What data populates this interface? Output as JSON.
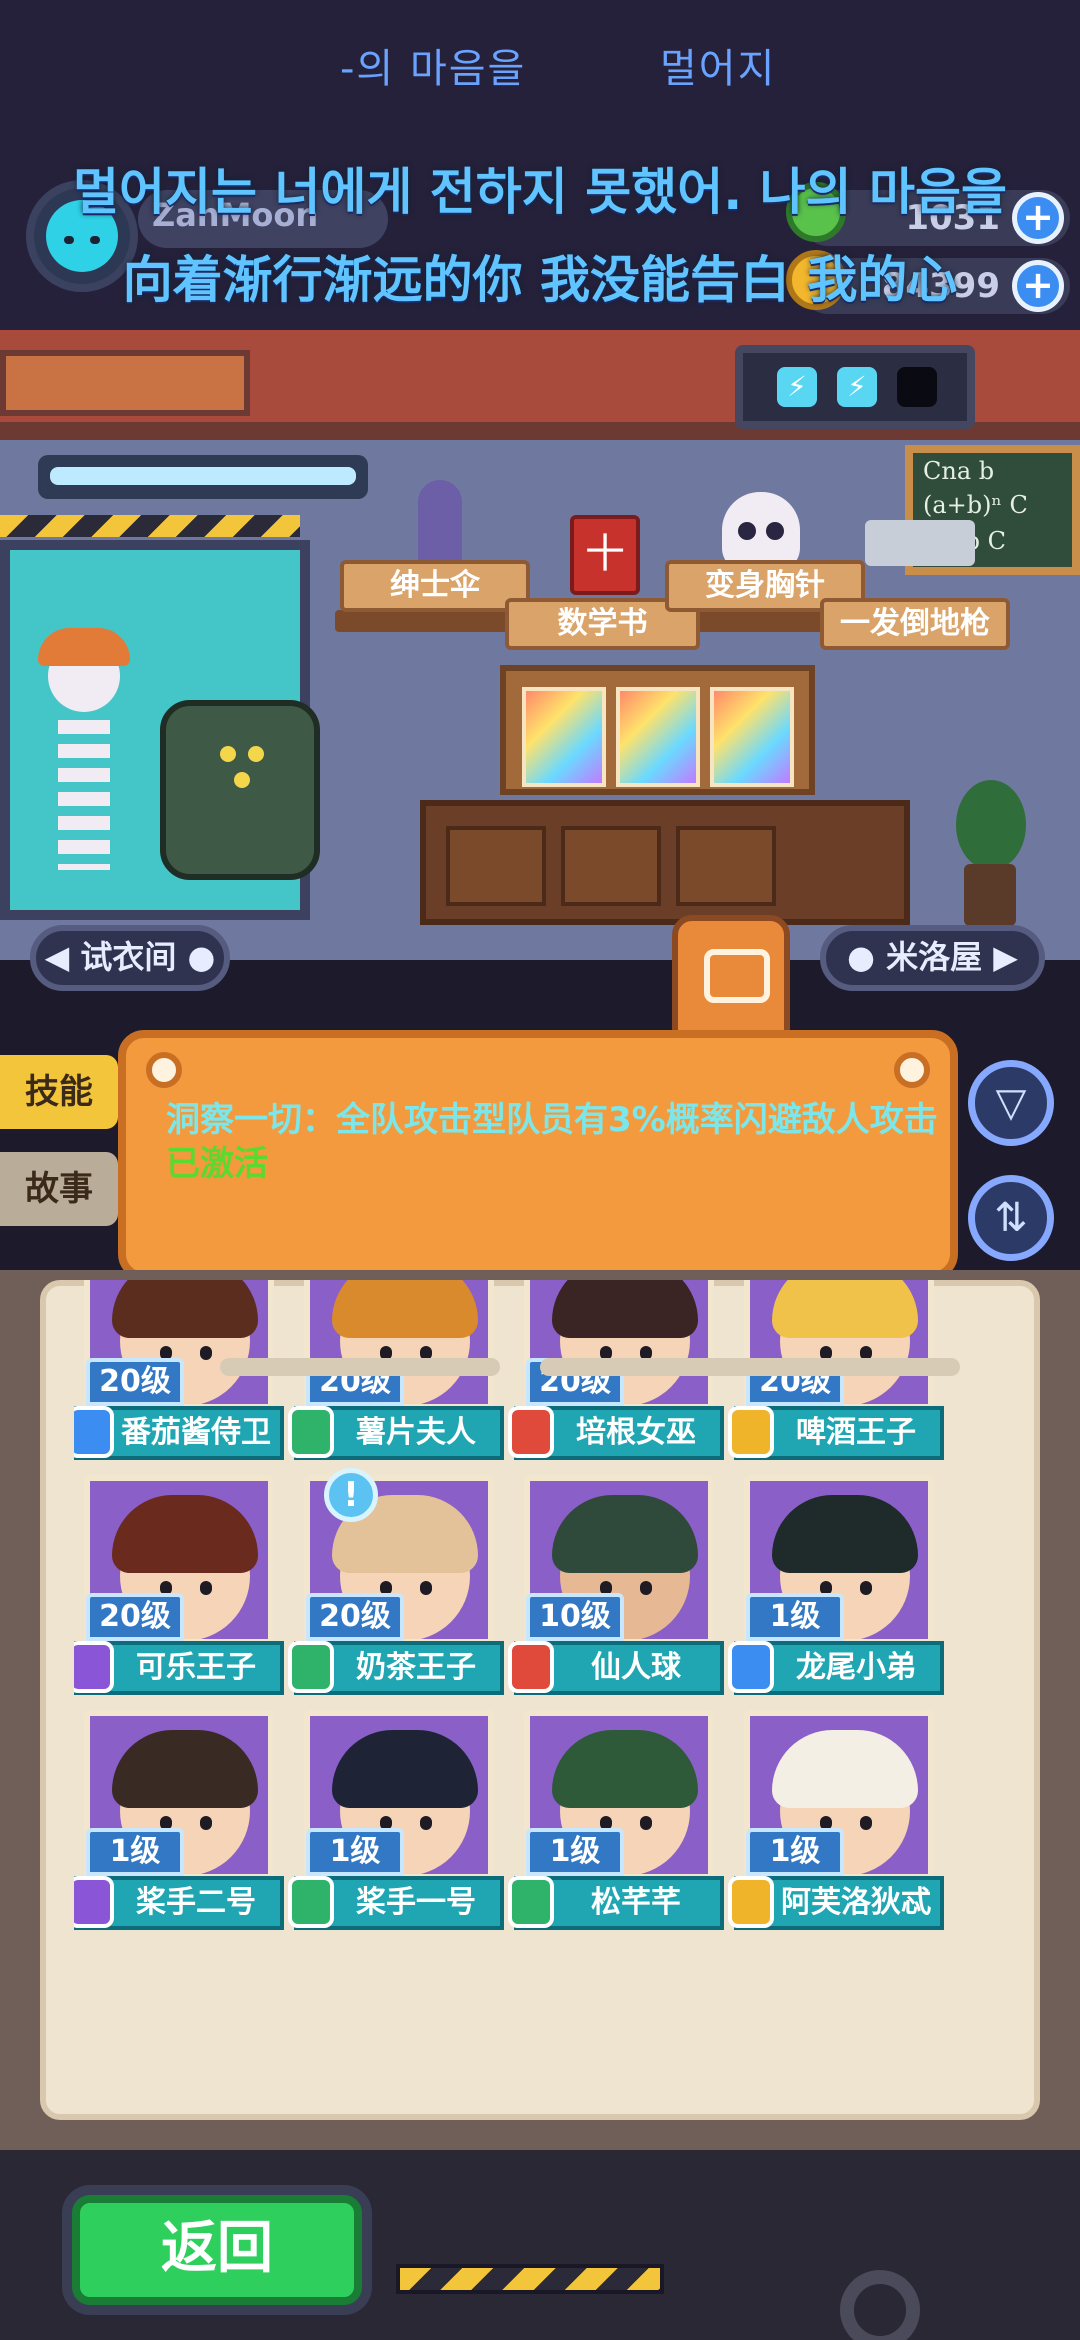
{
  "lyrics": {
    "top_fragment_left": "-의 마음을",
    "top_fragment_right": "멀어지",
    "korean": "멀어지는 너에게 전하지 못했어. 나의 마음을",
    "chinese": "向着渐行渐远的你 我没能告白 我的心"
  },
  "player": {
    "name": "ZanMoon",
    "currency_1": "1031",
    "currency_2": "84399",
    "plus_label": "+"
  },
  "energy": {
    "bolt_icon": "⚡"
  },
  "room_items": {
    "item_1": "绅士伞",
    "item_2": "数学书",
    "item_3": "变身胸针",
    "item_4": "一发倒地枪",
    "board_line_1": "Cna b",
    "board_line_2": "(a+b)ⁿ C",
    "board_line_3": "²a-²b C",
    "book_glyph": "⼗"
  },
  "nav": {
    "left_button": "◀ 试衣间 ●",
    "right_button": "● 米洛屋 ▶"
  },
  "side_tabs": {
    "skill": "技能",
    "story": "故事"
  },
  "skill_note": {
    "text": "洞察一切：全队攻击型队员有3%概率闪避敌人攻击",
    "status": "已激活"
  },
  "round_buttons": {
    "filter_icon": "▽",
    "sort_icon": "⇅"
  },
  "notice_badge": "!",
  "heroes": [
    {
      "level": "20级",
      "name": "番茄酱侍卫",
      "badge_color": "#3b8df1",
      "hair": "#5a2d1f",
      "skin": "#f6d4b8"
    },
    {
      "level": "20级",
      "name": "薯片夫人",
      "badge_color": "#2fb36a",
      "hair": "#d98a2c",
      "skin": "#f6d4b8"
    },
    {
      "level": "20级",
      "name": "培根女巫",
      "badge_color": "#e04a3a",
      "hair": "#3a2424",
      "skin": "#f6d4b8"
    },
    {
      "level": "20级",
      "name": "啤酒王子",
      "badge_color": "#f0b42a",
      "hair": "#f0c24a",
      "skin": "#f6d4b8"
    },
    {
      "level": "20级",
      "name": "可乐王子",
      "badge_color": "#8a55d6",
      "hair": "#6a2a1e",
      "skin": "#f6d4b8"
    },
    {
      "level": "20级",
      "name": "奶茶王子",
      "badge_color": "#2fb36a",
      "hair": "#e3c199",
      "skin": "#f6d4b8"
    },
    {
      "level": "10级",
      "name": "仙人球",
      "badge_color": "#e04a3a",
      "hair": "#2f4a3a",
      "skin": "#e7b894"
    },
    {
      "level": "1级",
      "name": "龙尾小弟",
      "badge_color": "#3b8df1",
      "hair": "#1f2a2a",
      "skin": "#f6d4b8"
    },
    {
      "level": "1级",
      "name": "桨手二号",
      "badge_color": "#8a55d6",
      "hair": "#3a2a24",
      "skin": "#f6d4b8"
    },
    {
      "level": "1级",
      "name": "桨手一号",
      "badge_color": "#2fb36a",
      "hair": "#1e2436",
      "skin": "#f6d4b8"
    },
    {
      "level": "1级",
      "name": "松芊芊",
      "badge_color": "#2fb36a",
      "hair": "#2f5a3a",
      "skin": "#f6d4b8"
    },
    {
      "level": "1级",
      "name": "阿芙洛狄忒",
      "badge_color": "#f0b42a",
      "hair": "#f4efe4",
      "skin": "#f6d4b8"
    }
  ],
  "back_button": "返回"
}
